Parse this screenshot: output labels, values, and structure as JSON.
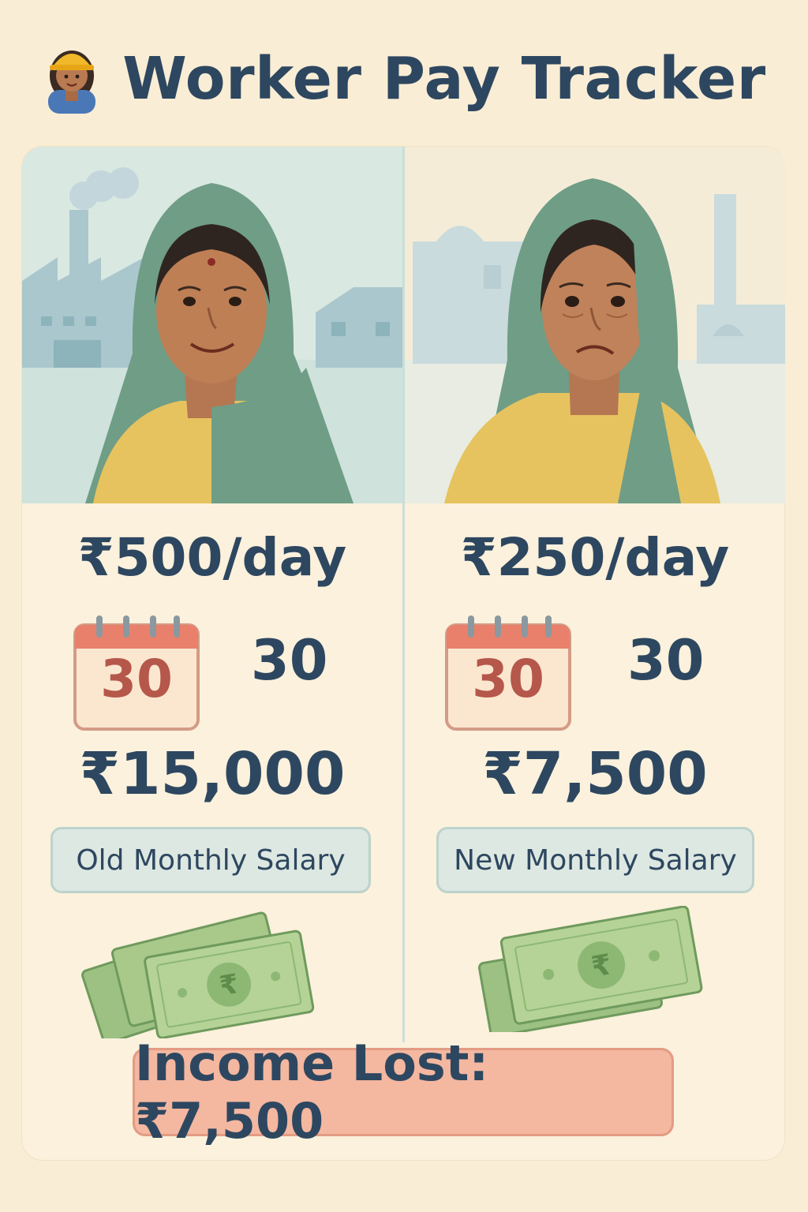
{
  "header": {
    "title": "Worker Pay Tracker",
    "icon": "worker-icon"
  },
  "before": {
    "daily_rate": "₹500/day",
    "calendar_number": "30",
    "days_worked": "30",
    "monthly_total": "₹15,000",
    "label": "Old Monthly Salary",
    "mood": "smiling"
  },
  "after": {
    "daily_rate": "₹250/day",
    "calendar_number": "30",
    "days_worked": "30",
    "monthly_total": "₹7,500",
    "label": "New Monthly Salary",
    "mood": "worried"
  },
  "summary": {
    "income_lost": "Income Lost: ₹7,500"
  },
  "colors": {
    "background": "#f9edd5",
    "text": "#2e4760",
    "scarf": "#6f9d86",
    "blouse": "#e6c35f",
    "skin": "#bf7f55",
    "calendar_header": "#e9806b",
    "money": "#a8c98a",
    "loss_banner": "#f4b7a0"
  }
}
